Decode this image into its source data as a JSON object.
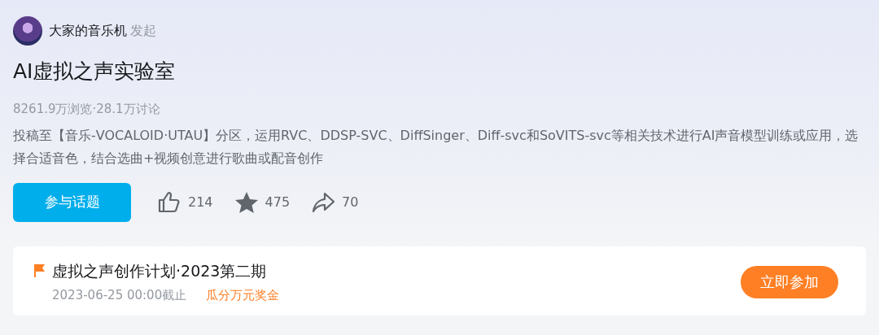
{
  "topic": {
    "initiator": "大家的音乐机",
    "initiator_suffix": "发起",
    "title": "AI虚拟之声实验室",
    "stats": "8261.9万浏览·28.1万讨论",
    "description": "投稿至【音乐-VOCALOID·UTAU】分区，运用RVC、DDSP-SVC、DiffSinger、Diff-svc和SoVITS-svc等相关技术进行AI声音模型训练或应用，选择合适音色，结合选曲+视频创意进行歌曲或配音创作",
    "join_button": "参与话题"
  },
  "actions": [
    {
      "kind": "like",
      "count": "214"
    },
    {
      "kind": "favorite",
      "count": "475"
    },
    {
      "kind": "share",
      "count": "70"
    }
  ],
  "event": {
    "title": "虚拟之声创作计划·2023第二期",
    "deadline": "2023-06-25 00:00截止",
    "reward": "瓜分万元奖金",
    "button": "立即参加"
  }
}
